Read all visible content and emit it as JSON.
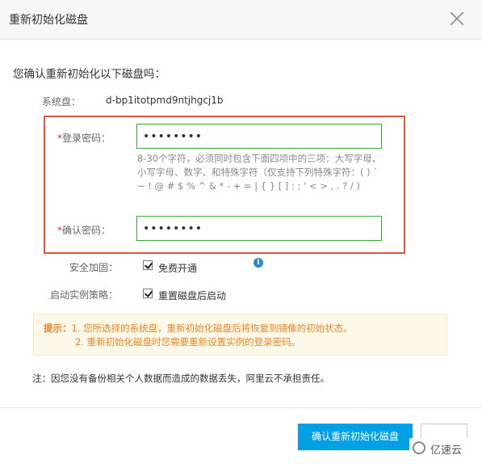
{
  "dialog": {
    "title": "重新初始化磁盘",
    "question": "您确认重新初始化以下磁盘吗：",
    "system_disk_label": "系统盘：",
    "system_disk_value": "d-bp1itotpmd9ntjhgcj1b",
    "login_pw_required": "*",
    "login_pw_label": "登录密码：",
    "login_pw_value": "••••••••",
    "pw_hint": "8-30个字符，必须同时包含下面四项中的三项：大写字母、小写字母、数字、和特殊字符（仅支持下列特殊字符：( ) ` ~ ! @ # $ % ^ & * - + = | { } [ ] : ; ' < > , . ? / )",
    "confirm_pw_required": "*",
    "confirm_pw_label": "确认密码：",
    "confirm_pw_value": "••••••••",
    "security_label": "安全加固：",
    "security_option": "免费开通",
    "security_checked": true,
    "info_icon": "i",
    "startup_label": "启动实例策略：",
    "startup_option": "重置磁盘后启动",
    "startup_checked": true,
    "tips_prefix": "提示：",
    "tip1": "1.  您所选择的系统盘，重新初始化磁盘后将恢复到镜像的初始状态。",
    "tip2": "2.  重新初始化磁盘时您需要重新设置实例的登录密码。",
    "note": "注：因您没有备份相关个人数据而造成的数据丢失，阿里云不承担责任。",
    "confirm_button": "确认重新初始化磁盘",
    "cancel_button": ""
  },
  "watermark": {
    "text": "亿速云",
    "icon": "yisu-logo-icon"
  },
  "colors": {
    "accent": "#00a0e6",
    "highlight_border": "#e0573f",
    "input_border": "#3da93d",
    "tip_text": "#e8862b"
  }
}
